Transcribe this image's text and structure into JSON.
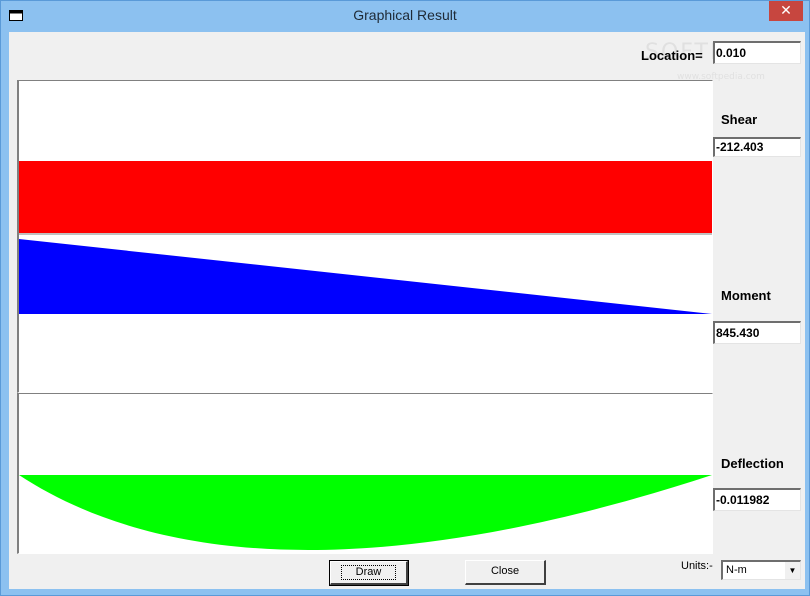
{
  "window": {
    "title": "Graphical Result",
    "close_glyph": "✕"
  },
  "location": {
    "label": "Location=",
    "value": "0.010"
  },
  "shear": {
    "label": "Shear",
    "value": "-212.403"
  },
  "moment": {
    "label": "Moment",
    "value": "845.430"
  },
  "deflection": {
    "label": "Deflection",
    "value": "-0.011982"
  },
  "buttons": {
    "draw": "Draw",
    "close": "Close"
  },
  "units": {
    "label": "Units:-",
    "selected": "N-m"
  },
  "watermark": {
    "logo": "SOFTPEDIA",
    "url": "www.softpedia.com"
  },
  "colors": {
    "shear": "#ff0000",
    "moment": "#0000ff",
    "deflection": "#00ff00"
  }
}
